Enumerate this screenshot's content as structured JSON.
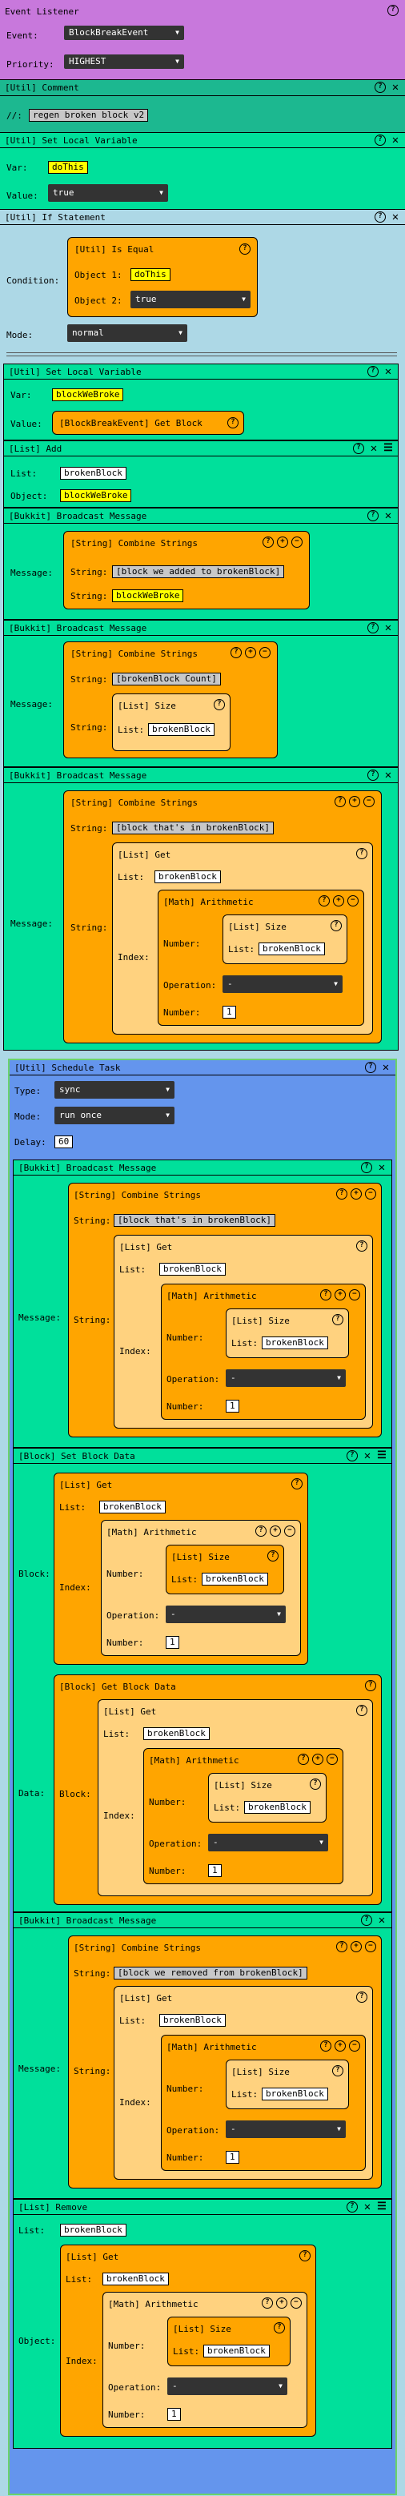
{
  "event_listener": {
    "title": "Event Listener",
    "event_label": "Event:",
    "event_value": "BlockBreakEvent",
    "priority_label": "Priority:",
    "priority_value": "HIGHEST"
  },
  "comment": {
    "title": "[Util] Comment",
    "prefix": "//:",
    "text": "regen broken block v2"
  },
  "set_var1": {
    "title": "[Util] Set Local Variable",
    "var_label": "Var:",
    "var_value": "doThis",
    "value_label": "Value:",
    "value_value": "true"
  },
  "if_stmt": {
    "title": "[Util] If Statement",
    "condition_label": "Condition:",
    "is_equal_title": "[Util] Is Equal",
    "obj1_label": "Object 1:",
    "obj1_value": "doThis",
    "obj2_label": "Object 2:",
    "obj2_value": "true",
    "mode_label": "Mode:",
    "mode_value": "normal"
  },
  "set_var2": {
    "title": "[Util] Set Local Variable",
    "var_label": "Var:",
    "var_value": "blockWeBroke",
    "value_label": "Value:",
    "value_block": "[BlockBreakEvent] Get Block"
  },
  "list_add": {
    "title": "[List] Add",
    "list_label": "List:",
    "list_value": "brokenBlock",
    "object_label": "Object:",
    "object_value": "blockWeBroke"
  },
  "bc1": {
    "title": "[Bukkit] Broadcast Message",
    "message_label": "Message:",
    "combine_title": "[String] Combine Strings",
    "string_label": "String:",
    "s1": "[block we added to brokenBlock]",
    "s2": "blockWeBroke"
  },
  "bc2": {
    "title": "[Bukkit] Broadcast Message",
    "message_label": "Message:",
    "combine_title": "[String] Combine Strings",
    "string_label": "String:",
    "s1": "[brokenBlock Count]",
    "size_title": "[List] Size",
    "list_label": "List:",
    "list_value": "brokenBlock"
  },
  "bc3": {
    "title": "[Bukkit] Broadcast Message",
    "message_label": "Message:",
    "combine_title": "[String] Combine Strings",
    "string_label": "String:",
    "s1": "[block that's in brokenBlock]",
    "get_title": "[List] Get",
    "list_label": "List:",
    "list_value": "brokenBlock",
    "index_label": "Index:",
    "arith_title": "[Math] Arithmetic",
    "number_label": "Number:",
    "size_title": "[List] Size",
    "size_list_value": "brokenBlock",
    "operation_label": "Operation:",
    "operation_value": "-",
    "number2_value": "1"
  },
  "sched": {
    "title": "[Util] Schedule Task",
    "type_label": "Type:",
    "type_value": "sync",
    "mode_label": "Mode:",
    "mode_value": "run once",
    "delay_label": "Delay:",
    "delay_value": "60"
  },
  "bc4": {
    "title": "[Bukkit] Broadcast Message",
    "message_label": "Message:",
    "combine_title": "[String] Combine Strings",
    "string_label": "String:",
    "s1": "[block that's in brokenBlock]",
    "get_title": "[List] Get",
    "list_label": "List:",
    "list_value": "brokenBlock",
    "index_label": "Index:",
    "arith_title": "[Math] Arithmetic",
    "number_label": "Number:",
    "size_title": "[List] Size",
    "size_list_value": "brokenBlock",
    "operation_label": "Operation:",
    "operation_value": "-",
    "number2_value": "1"
  },
  "setblock": {
    "title": "[Block] Set Block Data",
    "block_label": "Block:",
    "data_label": "Data:",
    "get_title": "[List] Get",
    "list_label": "List:",
    "list_value": "brokenBlock",
    "index_label": "Index:",
    "arith_title": "[Math] Arithmetic",
    "number_label": "Number:",
    "size_title": "[List] Size",
    "size_list_value": "brokenBlock",
    "operation_label": "Operation:",
    "operation_value": "-",
    "number2_value": "1",
    "getdata_title": "[Block] Get Block Data"
  },
  "bc5": {
    "title": "[Bukkit] Broadcast Message",
    "message_label": "Message:",
    "combine_title": "[String] Combine Strings",
    "string_label": "String:",
    "s1": "[block we removed from brokenBlock]",
    "get_title": "[List] Get",
    "list_label": "List:",
    "list_value": "brokenBlock",
    "index_label": "Index:",
    "arith_title": "[Math] Arithmetic",
    "number_label": "Number:",
    "size_title": "[List] Size",
    "size_list_value": "brokenBlock",
    "operation_label": "Operation:",
    "operation_value": "-",
    "number2_value": "1"
  },
  "remove": {
    "title": "[List] Remove",
    "list_label": "List:",
    "list_value": "brokenBlock",
    "object_label": "Object:",
    "get_title": "[List] Get",
    "get_list_value": "brokenBlock",
    "index_label": "Index:",
    "arith_title": "[Math] Arithmetic",
    "number_label": "Number:",
    "size_title": "[List] Size",
    "size_list_value": "brokenBlock",
    "operation_label": "Operation:",
    "operation_value": "-",
    "number2_value": "1"
  },
  "icons": {
    "help": "?",
    "close": "✕",
    "add": "+",
    "remove": "−",
    "menu": "☰",
    "dropdown": "▼"
  }
}
